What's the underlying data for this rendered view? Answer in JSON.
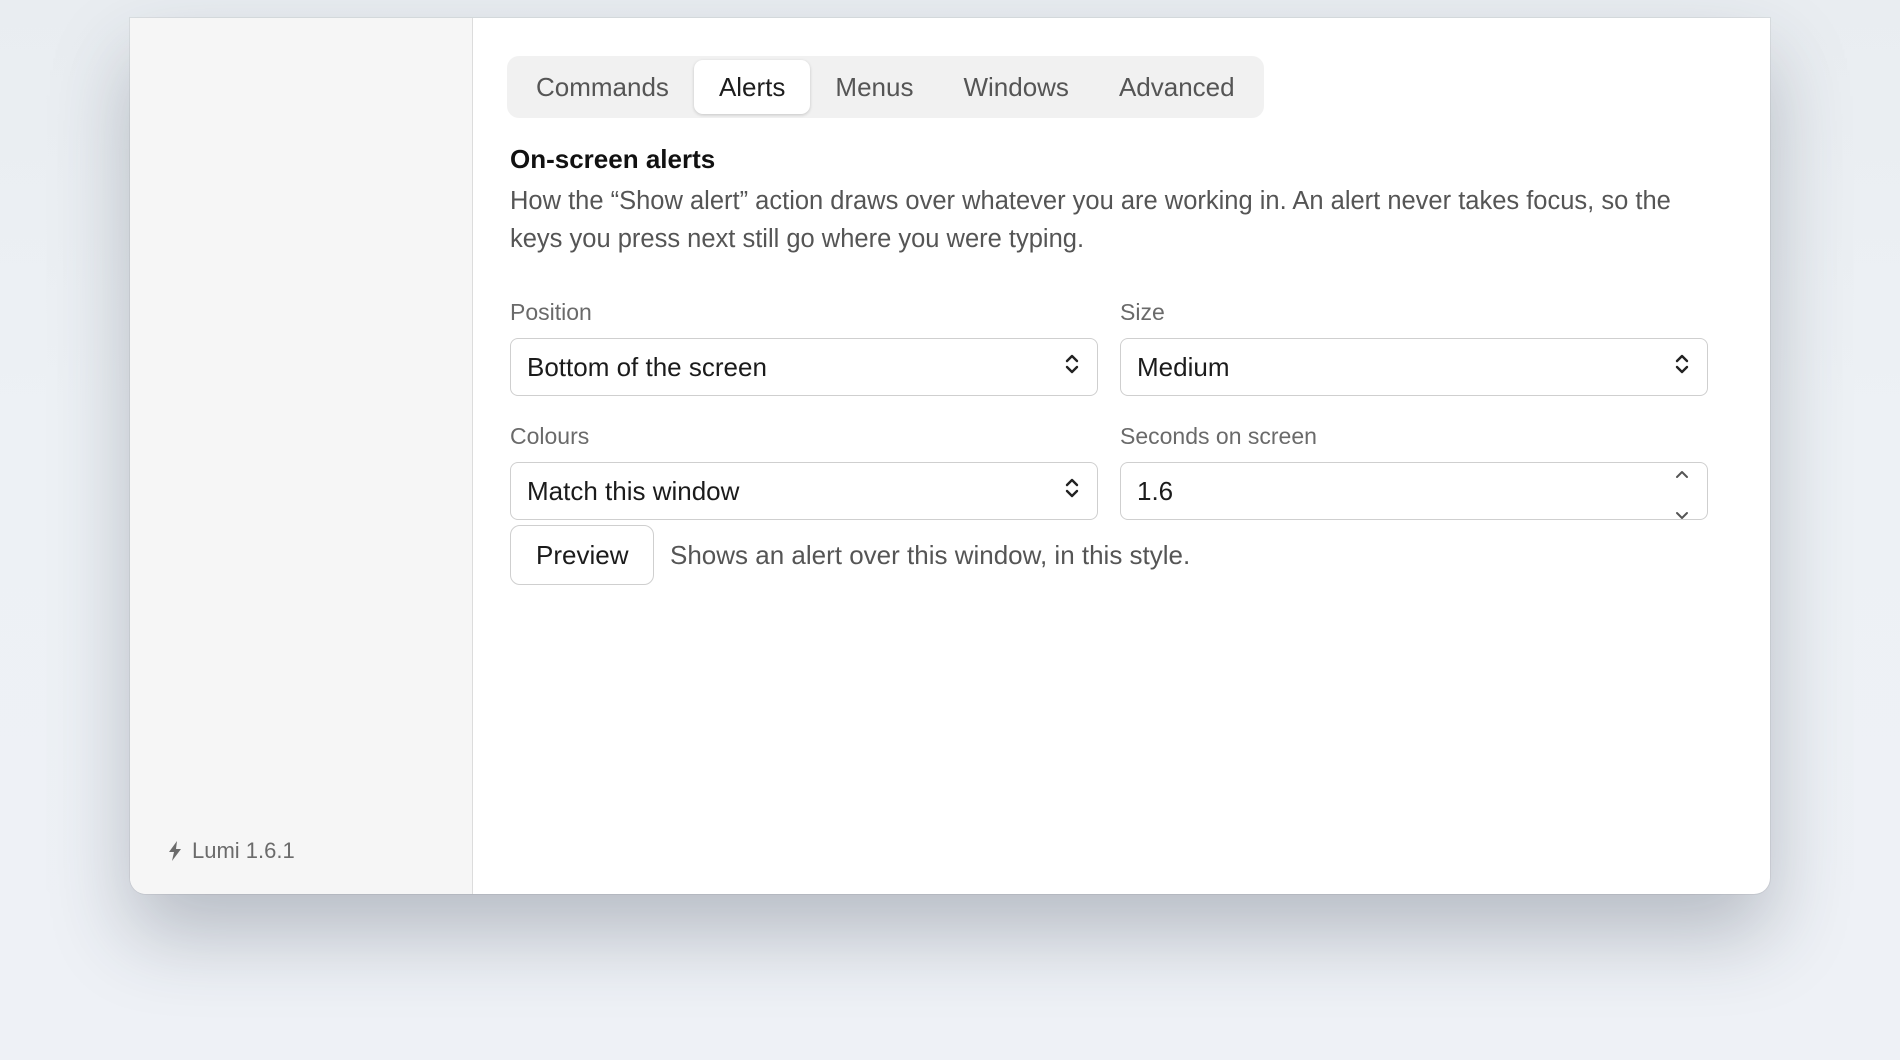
{
  "sidebar": {
    "version": "Lumi 1.6.1"
  },
  "tabs": [
    {
      "label": "Commands",
      "active": false
    },
    {
      "label": "Alerts",
      "active": true
    },
    {
      "label": "Menus",
      "active": false
    },
    {
      "label": "Windows",
      "active": false
    },
    {
      "label": "Advanced",
      "active": false
    }
  ],
  "section": {
    "title": "On-screen alerts",
    "description": "How the “Show alert” action draws over whatever you are working in. An alert never takes focus, so the keys you press next still go where you were typing."
  },
  "fields": {
    "position": {
      "label": "Position",
      "value": "Bottom of the screen"
    },
    "size": {
      "label": "Size",
      "value": "Medium"
    },
    "colours": {
      "label": "Colours",
      "value": "Match this window"
    },
    "seconds": {
      "label": "Seconds on screen",
      "value": "1.6"
    }
  },
  "preview": {
    "button_label": "Preview",
    "hint": "Shows an alert over this window, in this style."
  },
  "icons": {
    "version_icon": "bolt-icon",
    "select_icon": "chevron-up-down-icon",
    "stepper_icon": "stepper-arrows-icon"
  }
}
